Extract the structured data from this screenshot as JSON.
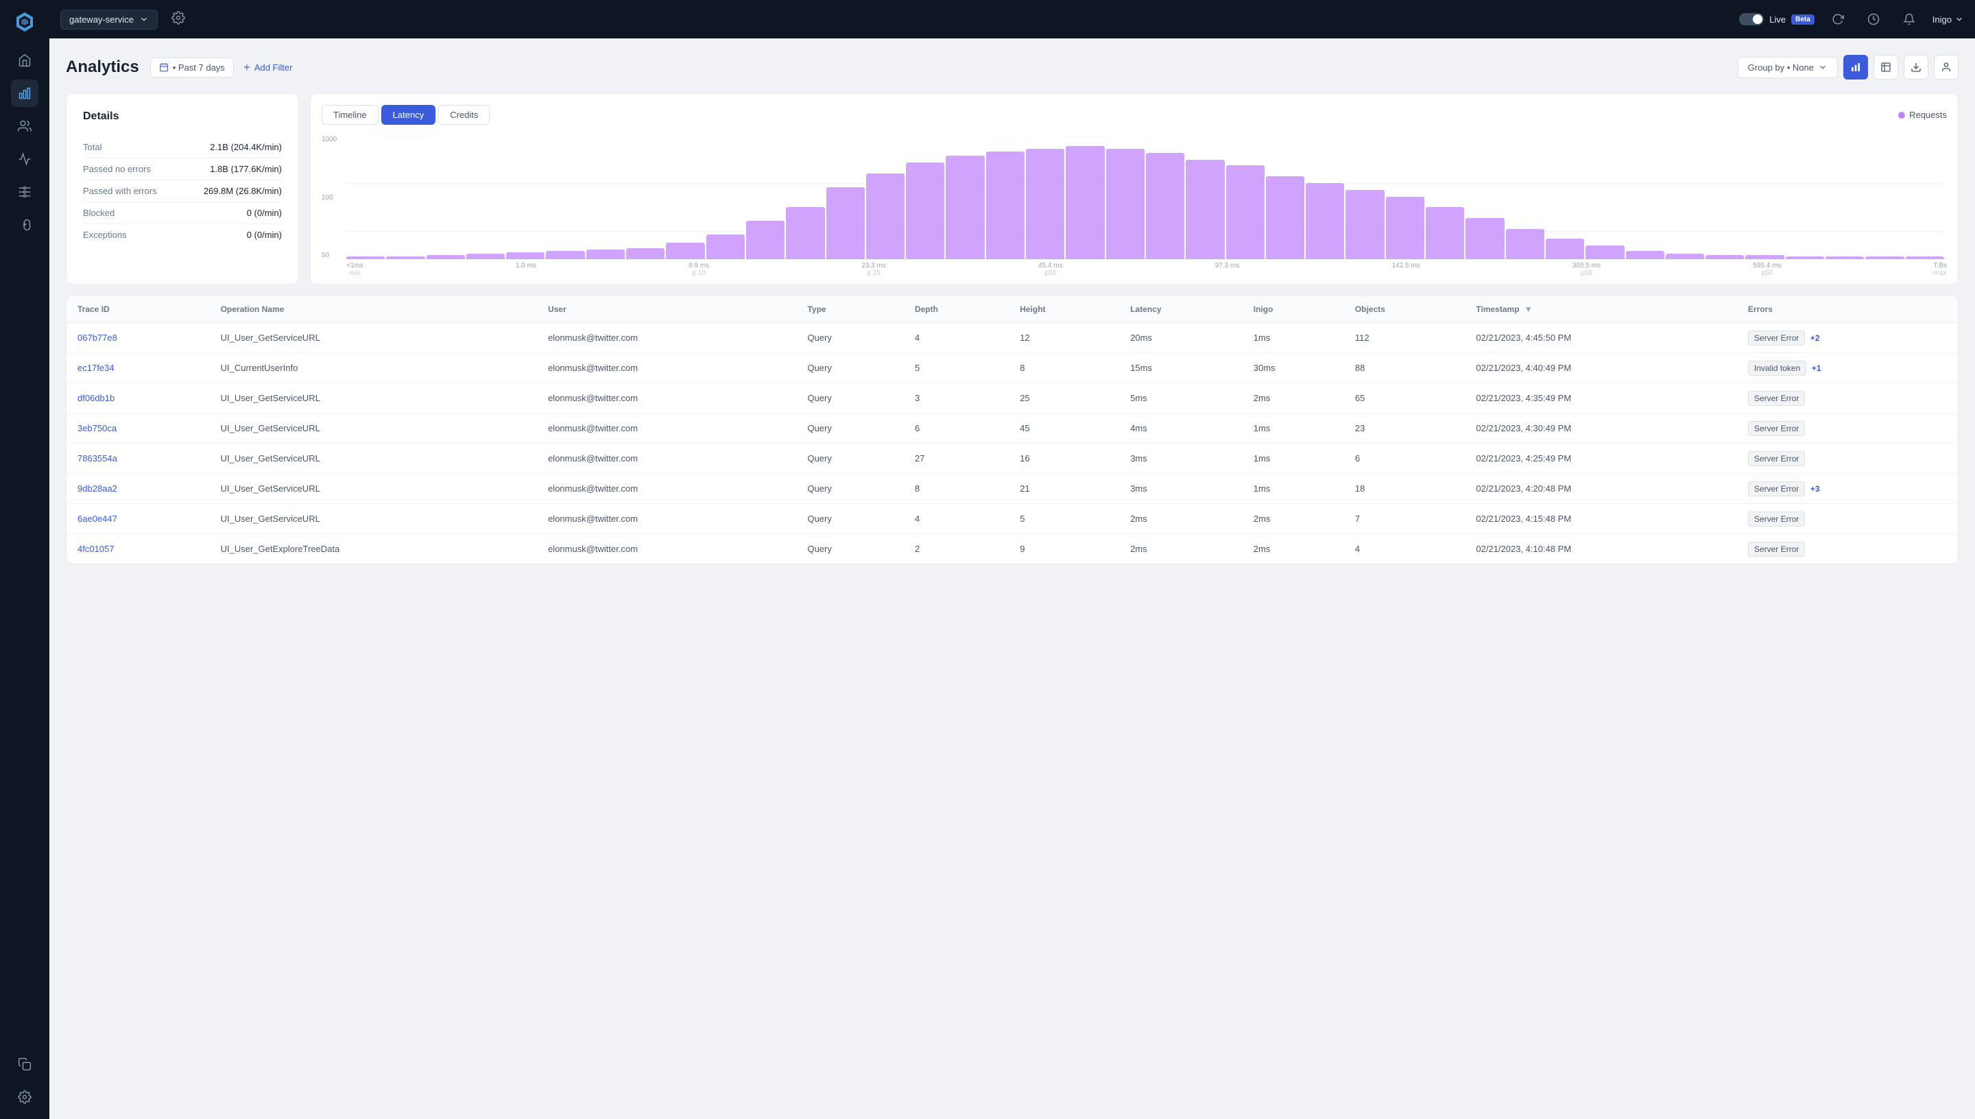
{
  "app": {
    "logo": "⬡",
    "service": "gateway-service",
    "live_label": "Live",
    "beta_label": "Beta",
    "user_name": "Inigo"
  },
  "sidebar": {
    "icons": [
      {
        "name": "home-icon",
        "symbol": "⌂",
        "active": false
      },
      {
        "name": "analytics-icon",
        "symbol": "📊",
        "active": true
      },
      {
        "name": "users-icon",
        "symbol": "👥",
        "active": false
      },
      {
        "name": "activity-icon",
        "symbol": "〜",
        "active": false
      },
      {
        "name": "filter-icon",
        "symbol": "⚙",
        "active": false
      },
      {
        "name": "gamepad-icon",
        "symbol": "🎮",
        "active": false
      },
      {
        "name": "bottom-icon",
        "symbol": "⊞",
        "active": false
      },
      {
        "name": "settings-icon",
        "symbol": "⋯",
        "active": false
      }
    ]
  },
  "header": {
    "title": "Analytics",
    "date_filter": "• Past 7 days",
    "add_filter": "Add Filter",
    "group_by_label": "Group by",
    "group_by_value": "None"
  },
  "details": {
    "title": "Details",
    "rows": [
      {
        "label": "Total",
        "value": "2.1B (204.4K/min)"
      },
      {
        "label": "Passed no errors",
        "value": "1.8B (177.6K/min)"
      },
      {
        "label": "Passed with errors",
        "value": "269.8M (26.8K/min)"
      },
      {
        "label": "Blocked",
        "value": "0 (0/min)"
      },
      {
        "label": "Exceptions",
        "value": "0 (0/min)"
      }
    ]
  },
  "chart": {
    "tabs": [
      "Timeline",
      "Latency",
      "Credits"
    ],
    "active_tab": "Latency",
    "legend": "Requests",
    "y_labels": [
      "1000",
      "100",
      "50"
    ],
    "x_labels": [
      {
        "top": "<1ms",
        "bottom": "min"
      },
      {
        "top": "1.0 ms",
        "bottom": ""
      },
      {
        "top": "9.9 ms",
        "bottom": "p 10"
      },
      {
        "top": "23.3 ms",
        "bottom": "p 25"
      },
      {
        "top": "45.4 ms",
        "bottom": "p52"
      },
      {
        "top": "97.3 ms",
        "bottom": ""
      },
      {
        "top": "142.5 ms",
        "bottom": ""
      },
      {
        "top": "305.5 ms",
        "bottom": "p55"
      },
      {
        "top": "595.4 ms",
        "bottom": "p50"
      },
      {
        "top": "T.Bs",
        "bottom": "max"
      }
    ],
    "bars": [
      2,
      2,
      3,
      4,
      5,
      6,
      7,
      8,
      12,
      18,
      28,
      38,
      52,
      62,
      70,
      75,
      78,
      80,
      82,
      80,
      77,
      72,
      68,
      60,
      55,
      50,
      45,
      38,
      30,
      22,
      15,
      10,
      6,
      4,
      3,
      3,
      2,
      2,
      2,
      2
    ]
  },
  "table": {
    "columns": [
      "Trace ID",
      "Operation Name",
      "User",
      "Type",
      "Depth",
      "Height",
      "Latency",
      "Inigo",
      "Objects",
      "Timestamp",
      "Errors"
    ],
    "rows": [
      {
        "trace_id": "067b77e8",
        "operation": "UI_User_GetServiceURL",
        "user": "elonmusk@twitter.com",
        "type": "Query",
        "depth": "4",
        "height": "12",
        "latency": "20ms",
        "inigo": "1ms",
        "objects": "112",
        "timestamp": "02/21/2023, 4:45:50 PM",
        "error": "Server Error",
        "plus": "+2"
      },
      {
        "trace_id": "ec17fe34",
        "operation": "UI_CurrentUserInfo",
        "user": "elonmusk@twitter.com",
        "type": "Query",
        "depth": "5",
        "height": "8",
        "latency": "15ms",
        "inigo": "30ms",
        "objects": "88",
        "timestamp": "02/21/2023, 4:40:49 PM",
        "error": "Invalid token",
        "plus": "+1"
      },
      {
        "trace_id": "df06db1b",
        "operation": "UI_User_GetServiceURL",
        "user": "elonmusk@twitter.com",
        "type": "Query",
        "depth": "3",
        "height": "25",
        "latency": "5ms",
        "inigo": "2ms",
        "objects": "65",
        "timestamp": "02/21/2023, 4:35:49 PM",
        "error": "Server Error",
        "plus": ""
      },
      {
        "trace_id": "3eb750ca",
        "operation": "UI_User_GetServiceURL",
        "user": "elonmusk@twitter.com",
        "type": "Query",
        "depth": "6",
        "height": "45",
        "latency": "4ms",
        "inigo": "1ms",
        "objects": "23",
        "timestamp": "02/21/2023, 4:30:49 PM",
        "error": "Server Error",
        "plus": ""
      },
      {
        "trace_id": "7863554a",
        "operation": "UI_User_GetServiceURL",
        "user": "elonmusk@twitter.com",
        "type": "Query",
        "depth": "27",
        "height": "16",
        "latency": "3ms",
        "inigo": "1ms",
        "objects": "6",
        "timestamp": "02/21/2023, 4:25:49 PM",
        "error": "Server Error",
        "plus": ""
      },
      {
        "trace_id": "9db28aa2",
        "operation": "UI_User_GetServiceURL",
        "user": "elonmusk@twitter.com",
        "type": "Query",
        "depth": "8",
        "height": "21",
        "latency": "3ms",
        "inigo": "1ms",
        "objects": "18",
        "timestamp": "02/21/2023, 4:20:48 PM",
        "error": "Server Error",
        "plus": "+3"
      },
      {
        "trace_id": "6ae0e447",
        "operation": "UI_User_GetServiceURL",
        "user": "elonmusk@twitter.com",
        "type": "Query",
        "depth": "4",
        "height": "5",
        "latency": "2ms",
        "inigo": "2ms",
        "objects": "7",
        "timestamp": "02/21/2023, 4:15:48 PM",
        "error": "Server Error",
        "plus": ""
      },
      {
        "trace_id": "4fc01057",
        "operation": "UI_User_GetExploreTreeData",
        "user": "elonmusk@twitter.com",
        "type": "Query",
        "depth": "2",
        "height": "9",
        "latency": "2ms",
        "inigo": "2ms",
        "objects": "4",
        "timestamp": "02/21/2023, 4:10:48 PM",
        "error": "Server Error",
        "plus": ""
      }
    ]
  }
}
